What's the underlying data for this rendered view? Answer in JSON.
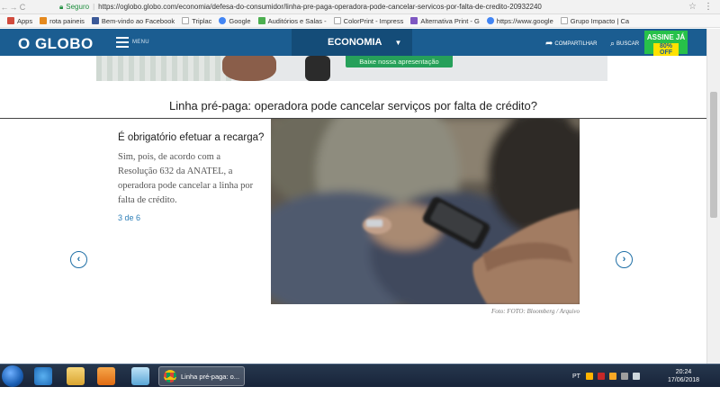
{
  "browser": {
    "secure_label": "Seguro",
    "url": "https://oglobo.globo.com/economia/defesa-do-consumidor/linha-pre-paga-operadora-pode-cancelar-servicos-por-falta-de-credito-20932240",
    "bookmarks": [
      "Apps",
      "rota paineis",
      "Bem-vindo ao Facebook",
      "Triplac",
      "Google",
      "Auditórios e Salas -",
      "ColorPrint - Impress",
      "Alternativa Print - G",
      "https://www.google",
      "Grupo Impacto | Ca"
    ]
  },
  "site": {
    "logo": "O GLOBO",
    "menu_label": "MENU",
    "section": "ECONOMIA",
    "share_label": "COMPARTILHAR",
    "search_label": "BUSCAR",
    "subscribe_top": "ASSINE JÁ",
    "subscribe_bottom": "80% OFF"
  },
  "ad": {
    "button_label": "Baixe nossa apresentação"
  },
  "article": {
    "title": "Linha pré-paga: operadora pode cancelar serviços por falta de crédito?",
    "slide_heading": "É obrigatório efetuar a recarga?",
    "slide_body": "Sim, pois, de acordo com a Resolução 632 da ANATEL, a operadora pode cancelar a linha por falta de crédito.",
    "slide_counter": "3 de 6",
    "photo_caption": "Foto: FOTO: Bloomberg / Arquivo"
  },
  "taskbar": {
    "active_window": "Linha pré-paga: o...",
    "language": "PT",
    "time": "20:24",
    "date": "17/06/2018"
  },
  "colors": {
    "header_blue": "#1b5d91",
    "accent_green": "#27c14a",
    "link_blue": "#2e7fb8"
  }
}
